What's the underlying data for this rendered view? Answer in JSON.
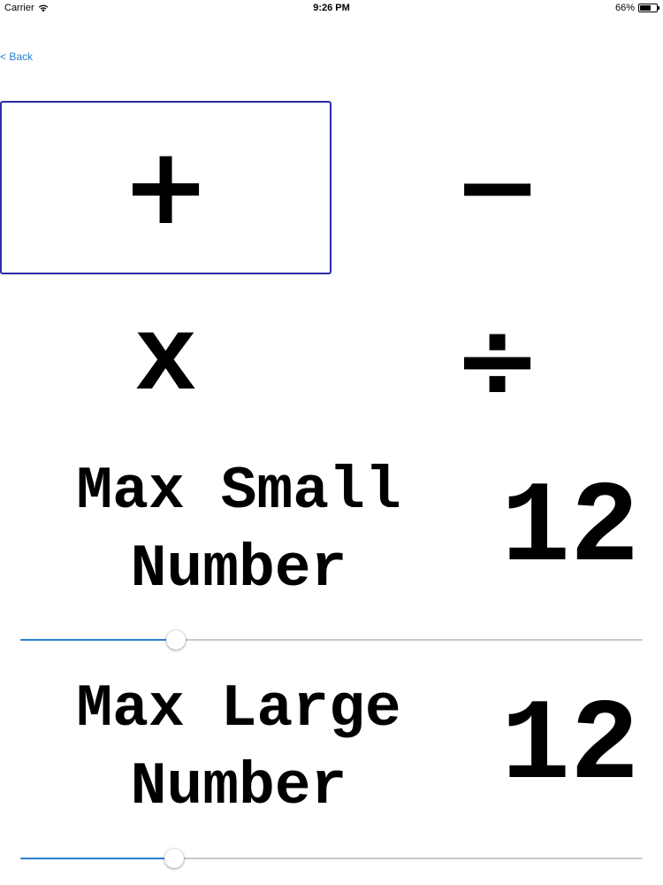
{
  "status_bar": {
    "carrier": "Carrier",
    "time": "9:26 PM",
    "battery_percent": "66%",
    "battery_level": 0.66,
    "wifi_icon": "wifi-icon"
  },
  "nav": {
    "back_label": "< Back"
  },
  "operations": {
    "plus": "+",
    "minus": "−",
    "times": "x",
    "divide": "÷",
    "selected": "plus",
    "selected_border_color": "#2d2aa8"
  },
  "settings": {
    "max_small": {
      "label": "Max Small\nNumber",
      "value": "12",
      "slider_fraction": 0.25
    },
    "max_large": {
      "label": "Max Large\nNumber",
      "value": "12",
      "slider_fraction": 0.247
    }
  },
  "colors": {
    "accent": "#2a7fd0",
    "track": "#c9c9c9"
  }
}
